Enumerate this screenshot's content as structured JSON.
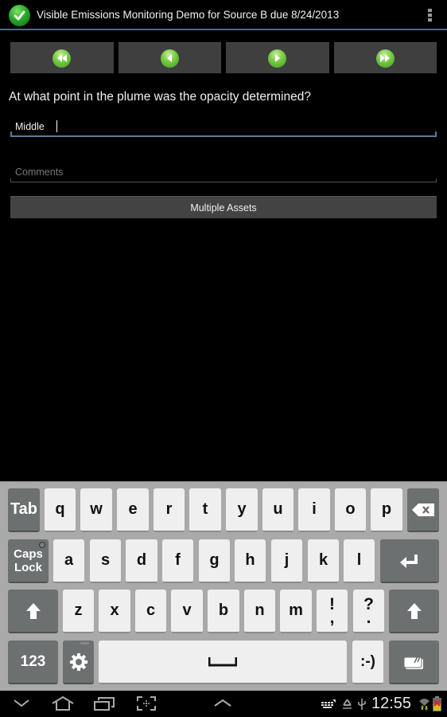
{
  "action_bar": {
    "app_icon": "green-check-icon",
    "title": "Visible Emissions Monitoring Demo for Source B due 8/24/2013",
    "overflow_icon": "overflow-menu-icon"
  },
  "nav_buttons": [
    {
      "name": "first",
      "icon": "rewind-icon"
    },
    {
      "name": "previous",
      "icon": "previous-icon"
    },
    {
      "name": "next",
      "icon": "next-icon"
    },
    {
      "name": "last",
      "icon": "fast-forward-icon"
    }
  ],
  "form": {
    "question": "At what point in the plume was the opacity determined?",
    "answer_value": "Middle",
    "comments_placeholder": "Comments",
    "comments_value": "",
    "multiple_assets_label": "Multiple Assets"
  },
  "keyboard": {
    "row1": [
      "Tab",
      "q",
      "w",
      "e",
      "r",
      "t",
      "y",
      "u",
      "i",
      "o",
      "p",
      "backspace"
    ],
    "row2": [
      "Caps Lock",
      "a",
      "s",
      "d",
      "f",
      "g",
      "h",
      "j",
      "k",
      "l",
      "enter"
    ],
    "row3": [
      "shift",
      "z",
      "x",
      "c",
      "v",
      "b",
      "n",
      "m",
      "!,",
      "?.",
      "shift"
    ],
    "row4": [
      "123",
      "settings",
      "space",
      ":-)",
      "clipboard"
    ],
    "labels": {
      "tab": "Tab",
      "caps_line1": "Caps",
      "caps_line2": "Lock",
      "num": "123",
      "smiley": ":-)",
      "excl_top": "!",
      "excl_bottom": ",",
      "quest_top": "?",
      "quest_bottom": "."
    }
  },
  "system_bar": {
    "time": "12:55",
    "left_icons": [
      "keyboard-hide-icon",
      "home-icon",
      "recent-apps-icon",
      "screenshot-icon",
      "menu-up-icon"
    ],
    "right_icons": [
      "keyboard-icon",
      "recycle-icon",
      "usb-icon",
      "wifi-icon",
      "battery-icon"
    ]
  }
}
